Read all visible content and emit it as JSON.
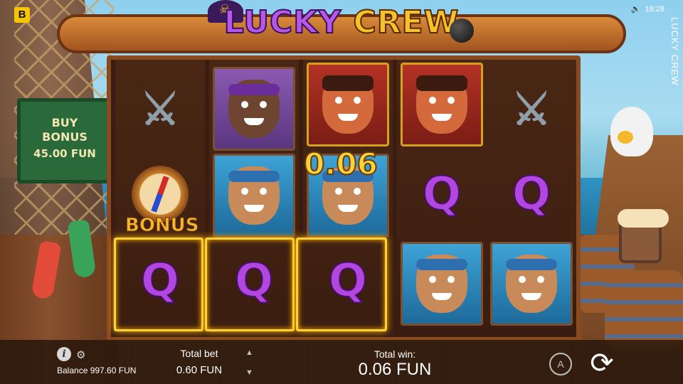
{
  "header": {
    "brand_badge": "B",
    "logo_word1": "LUCKY",
    "logo_word2": "CREW",
    "side_title": "LUCKY CREW",
    "clock": "18:28",
    "sound_icon": "speaker-icon"
  },
  "buy_bonus": {
    "line1": "BUY",
    "line2": "BONUS",
    "price": "45.00 FUN"
  },
  "reels": {
    "columns": [
      [
        "swords",
        "bonus-compass",
        "Q"
      ],
      [
        "pirate",
        "sailor",
        "Q"
      ],
      [
        "captain",
        "sailor",
        "Q"
      ],
      [
        "captain",
        "Q",
        "sailor"
      ],
      [
        "swords",
        "Q",
        "sailor"
      ]
    ],
    "bonus_label": "BONUS",
    "win_highlight": "0.06",
    "colors": {
      "win_frame": "#ffd23a",
      "q_symbol": "#b247e0"
    }
  },
  "footer": {
    "balance_label": "Balance 997.60 FUN",
    "total_bet_label": "Total bet",
    "total_bet_value": "0.60 FUN",
    "total_win_label": "Total win:",
    "total_win_value": "0.06 FUN",
    "auto_label": "A",
    "info_icon": "info-icon",
    "settings_icon": "gear-icon",
    "spin_icon": "spin-icon"
  }
}
